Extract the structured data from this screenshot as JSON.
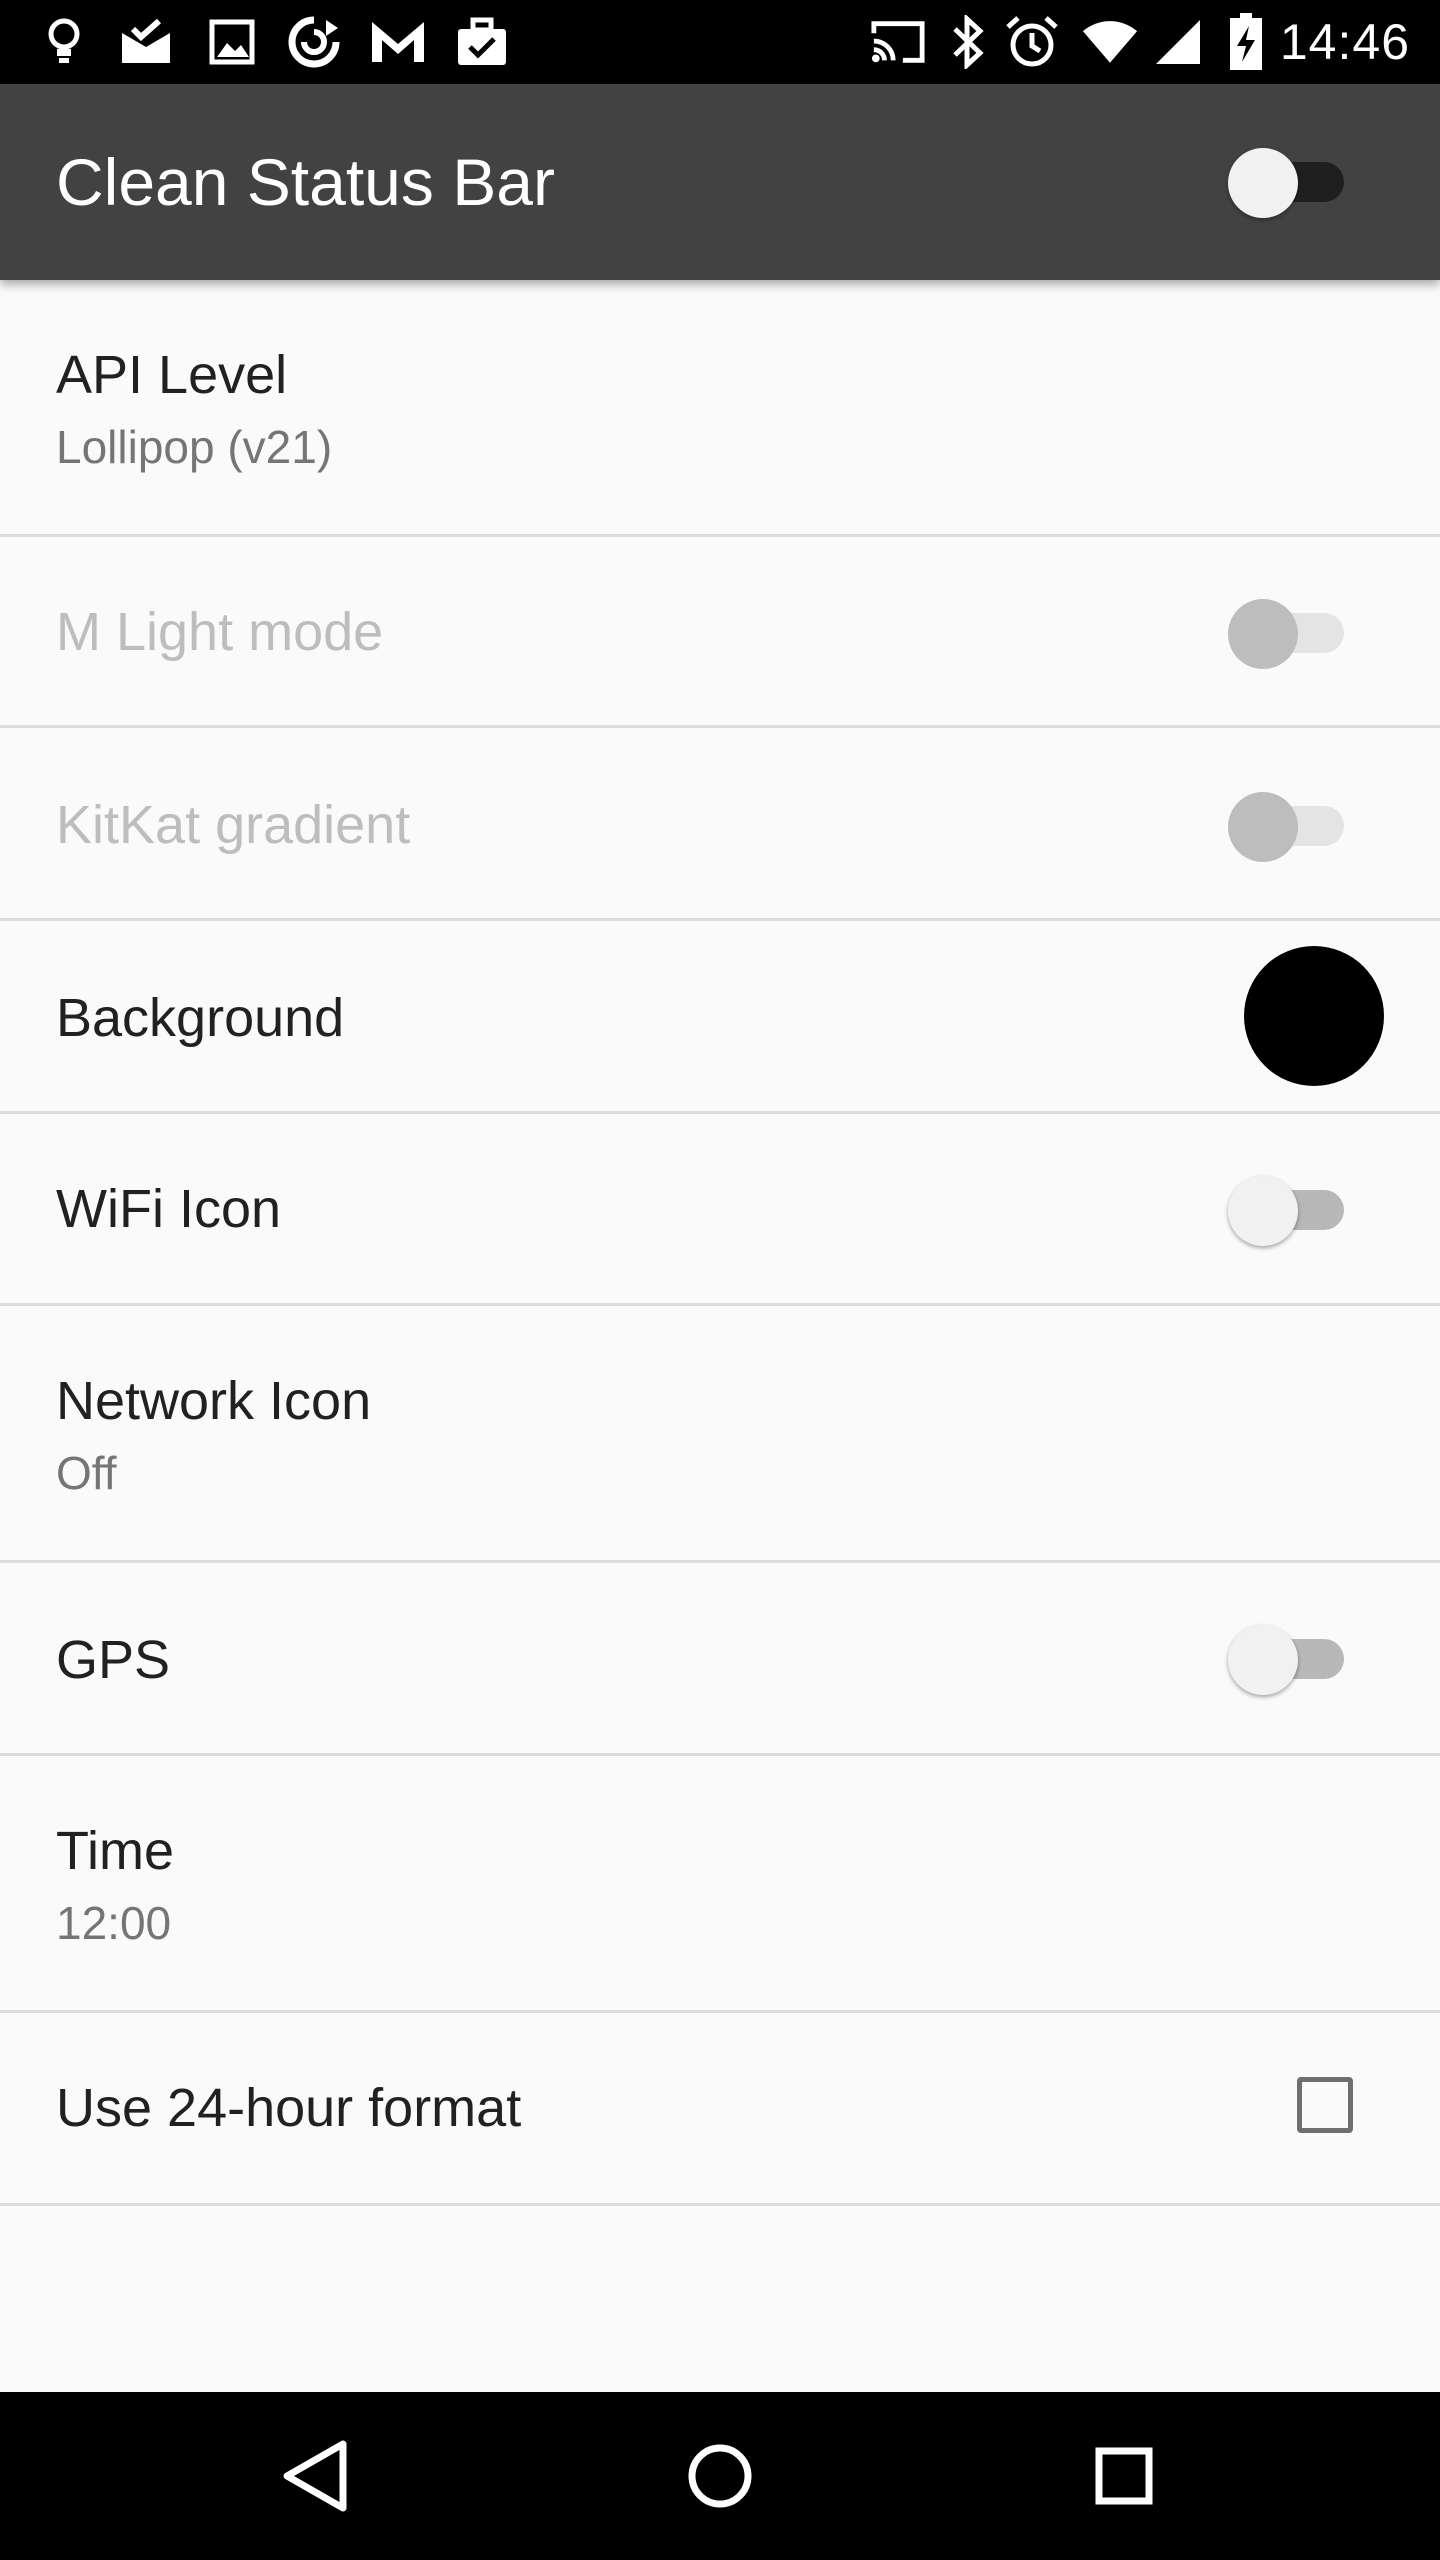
{
  "status_bar": {
    "time": "14:46",
    "left_icons": [
      "lightbulb-icon",
      "mail-check-icon",
      "image-icon",
      "sync-icon",
      "gmail-icon",
      "briefcase-check-icon"
    ],
    "right_icons": [
      "cast-icon",
      "bluetooth-icon",
      "alarm-icon",
      "wifi-icon",
      "cell-signal-icon",
      "battery-charging-icon"
    ]
  },
  "app_bar": {
    "title": "Clean Status Bar",
    "master_switch": "off"
  },
  "preferences": [
    {
      "title": "API Level",
      "summary": "Lollipop (v21)"
    },
    {
      "title": "M Light mode",
      "widget": "switch",
      "state": "off",
      "enabled": false
    },
    {
      "title": "KitKat gradient",
      "widget": "switch",
      "state": "off",
      "enabled": false
    },
    {
      "title": "Background",
      "widget": "color",
      "color": "#000000"
    },
    {
      "title": "WiFi Icon",
      "widget": "switch",
      "state": "off",
      "enabled": true
    },
    {
      "title": "Network Icon",
      "summary": "Off"
    },
    {
      "title": "GPS",
      "widget": "switch",
      "state": "off",
      "enabled": true
    },
    {
      "title": "Time",
      "summary": "12:00"
    },
    {
      "title": "Use 24-hour format",
      "widget": "checkbox",
      "checked": false
    }
  ],
  "nav_bar": {
    "back": "back-triangle-icon",
    "home": "home-circle-icon",
    "recents": "recents-square-icon"
  },
  "colors": {
    "app_bar": "#424242",
    "background": "#fafafa",
    "divider": "#dcdcdc"
  }
}
